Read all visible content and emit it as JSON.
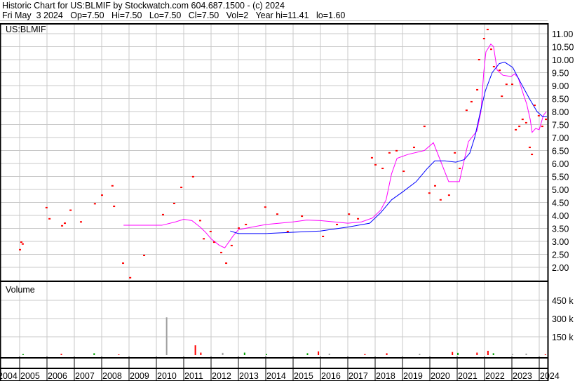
{
  "header": {
    "title": "Historic Chart for US:BLMIF by Stockwatch.com 604.687.1500 - (c) 2024",
    "quote": "Fri May  3 2024   Op=7.50   Hi=7.50   Lo=7.50   Cl=7.50   Vol=2   Year hi=11.41   lo=1.60"
  },
  "chart_data": {
    "type": "line",
    "title": "US:BLMIF",
    "volume_label": "Volume",
    "colors": {
      "price": "#ff0000",
      "ma_short": "#ff00ff",
      "ma_long": "#0000ff",
      "grid": "#c8c8c8",
      "vol_up": "#00a000",
      "vol_down": "#ff0000",
      "vol_flat": "#a0a0a0"
    },
    "price_axis": {
      "range": [
        1.6,
        11.4
      ],
      "ticks": [
        "11.00",
        "10.50",
        "10.00",
        "9.50",
        "9.00",
        "8.50",
        "8.00",
        "7.50",
        "7.00",
        "6.50",
        "6.00",
        "5.50",
        "5.00",
        "4.50",
        "4.00",
        "3.50",
        "3.00",
        "2.50",
        "2.00"
      ]
    },
    "volume_axis": {
      "range": [
        0,
        500000
      ],
      "ticks": [
        {
          "v": 450000,
          "label": "450 k"
        },
        {
          "v": 300000,
          "label": "300 k"
        },
        {
          "v": 150000,
          "label": "150 k"
        }
      ]
    },
    "x_axis": {
      "range": [
        2004.3,
        2024.4
      ],
      "years": [
        "2004",
        "2005",
        "2006",
        "2007",
        "2008",
        "2009",
        "2010",
        "2011",
        "2012",
        "2013",
        "2014",
        "2015",
        "2016",
        "2017",
        "2018",
        "2019",
        "2020",
        "2021",
        "2022",
        "2023",
        "2024"
      ]
    },
    "prices": [
      [
        2005.0,
        2.68
      ],
      [
        2005.05,
        2.97
      ],
      [
        2005.1,
        2.9
      ],
      [
        2005.97,
        4.3
      ],
      [
        2006.08,
        3.87
      ],
      [
        2006.54,
        3.6
      ],
      [
        2006.64,
        3.7
      ],
      [
        2006.85,
        4.2
      ],
      [
        2007.23,
        3.75
      ],
      [
        2007.74,
        4.45
      ],
      [
        2008.0,
        4.78
      ],
      [
        2008.38,
        5.14
      ],
      [
        2008.44,
        4.35
      ],
      [
        2008.77,
        2.16
      ],
      [
        2009.03,
        1.6
      ],
      [
        2009.54,
        2.46
      ],
      [
        2010.23,
        4.03
      ],
      [
        2010.64,
        4.46
      ],
      [
        2010.9,
        5.08
      ],
      [
        2011.33,
        5.49
      ],
      [
        2011.59,
        3.8
      ],
      [
        2011.72,
        3.1
      ],
      [
        2011.97,
        3.38
      ],
      [
        2012.1,
        2.97
      ],
      [
        2012.36,
        2.57
      ],
      [
        2012.54,
        2.16
      ],
      [
        2012.74,
        2.84
      ],
      [
        2013.0,
        3.51
      ],
      [
        2013.26,
        3.65
      ],
      [
        2013.97,
        4.32
      ],
      [
        2014.41,
        4.05
      ],
      [
        2014.79,
        3.38
      ],
      [
        2015.31,
        3.97
      ],
      [
        2016.08,
        3.19
      ],
      [
        2016.59,
        3.65
      ],
      [
        2017.03,
        4.05
      ],
      [
        2017.36,
        3.87
      ],
      [
        2017.87,
        6.22
      ],
      [
        2018.0,
        5.95
      ],
      [
        2018.26,
        5.81
      ],
      [
        2018.51,
        6.41
      ],
      [
        2018.77,
        6.49
      ],
      [
        2019.03,
        5.7
      ],
      [
        2019.41,
        6.62
      ],
      [
        2019.79,
        7.43
      ],
      [
        2019.97,
        4.86
      ],
      [
        2020.18,
        5.14
      ],
      [
        2020.38,
        4.6
      ],
      [
        2020.69,
        4.78
      ],
      [
        2020.9,
        6.41
      ],
      [
        2021.08,
        5.81
      ],
      [
        2021.33,
        8.05
      ],
      [
        2021.51,
        8.38
      ],
      [
        2021.72,
        8.84
      ],
      [
        2021.79,
        10.0
      ],
      [
        2021.97,
        10.81
      ],
      [
        2022.1,
        11.16
      ],
      [
        2022.23,
        10.4
      ],
      [
        2022.33,
        9.73
      ],
      [
        2022.54,
        9.59
      ],
      [
        2022.62,
        8.59
      ],
      [
        2022.79,
        9.05
      ],
      [
        2023.0,
        9.05
      ],
      [
        2023.13,
        7.3
      ],
      [
        2023.26,
        7.43
      ],
      [
        2023.38,
        7.7
      ],
      [
        2023.51,
        7.57
      ],
      [
        2023.64,
        6.62
      ],
      [
        2023.72,
        6.35
      ],
      [
        2023.82,
        8.24
      ],
      [
        2023.97,
        7.84
      ],
      [
        2024.1,
        7.43
      ],
      [
        2024.23,
        7.7
      ]
    ],
    "series": [
      {
        "name": "short moving average",
        "points": [
          [
            2008.8,
            3.62
          ],
          [
            2009.5,
            3.62
          ],
          [
            2010.2,
            3.62
          ],
          [
            2010.7,
            3.75
          ],
          [
            2011.0,
            3.85
          ],
          [
            2011.3,
            3.8
          ],
          [
            2011.6,
            3.55
          ],
          [
            2011.8,
            3.35
          ],
          [
            2012.0,
            3.1
          ],
          [
            2012.3,
            2.85
          ],
          [
            2012.5,
            2.75
          ],
          [
            2012.8,
            3.2
          ],
          [
            2013.0,
            3.45
          ],
          [
            2013.5,
            3.55
          ],
          [
            2014.0,
            3.65
          ],
          [
            2014.5,
            3.7
          ],
          [
            2015.0,
            3.75
          ],
          [
            2015.5,
            3.82
          ],
          [
            2016.0,
            3.8
          ],
          [
            2016.5,
            3.75
          ],
          [
            2017.0,
            3.7
          ],
          [
            2017.5,
            3.75
          ],
          [
            2017.9,
            3.9
          ],
          [
            2018.2,
            4.2
          ],
          [
            2018.4,
            4.6
          ],
          [
            2018.6,
            5.6
          ],
          [
            2018.8,
            6.2
          ],
          [
            2019.2,
            6.35
          ],
          [
            2019.8,
            6.5
          ],
          [
            2020.13,
            6.8
          ],
          [
            2020.69,
            5.3
          ],
          [
            2021.08,
            5.3
          ],
          [
            2021.41,
            6.84
          ],
          [
            2021.72,
            7.25
          ],
          [
            2021.87,
            8.0
          ],
          [
            2021.97,
            9.5
          ],
          [
            2022.05,
            10.3
          ],
          [
            2022.23,
            10.6
          ],
          [
            2022.33,
            10.5
          ],
          [
            2022.46,
            9.6
          ],
          [
            2022.67,
            9.4
          ],
          [
            2022.97,
            9.35
          ],
          [
            2023.1,
            9.45
          ],
          [
            2023.23,
            9.3
          ],
          [
            2023.44,
            8.6
          ],
          [
            2023.54,
            8.3
          ],
          [
            2023.67,
            7.7
          ],
          [
            2023.74,
            7.2
          ],
          [
            2023.87,
            7.35
          ],
          [
            2024.0,
            7.3
          ],
          [
            2024.15,
            7.85
          ],
          [
            2024.26,
            8.0
          ]
        ]
      },
      {
        "name": "long moving average",
        "points": [
          [
            2012.7,
            3.4
          ],
          [
            2013.0,
            3.3
          ],
          [
            2014.0,
            3.3
          ],
          [
            2015.0,
            3.35
          ],
          [
            2016.0,
            3.4
          ],
          [
            2017.0,
            3.55
          ],
          [
            2017.8,
            3.7
          ],
          [
            2018.2,
            4.1
          ],
          [
            2018.6,
            4.6
          ],
          [
            2019.0,
            4.9
          ],
          [
            2019.5,
            5.3
          ],
          [
            2019.9,
            5.8
          ],
          [
            2020.18,
            6.1
          ],
          [
            2020.56,
            6.1
          ],
          [
            2020.95,
            6.05
          ],
          [
            2021.26,
            6.15
          ],
          [
            2021.46,
            6.4
          ],
          [
            2021.64,
            7.0
          ],
          [
            2021.85,
            8.0
          ],
          [
            2022.03,
            8.8
          ],
          [
            2022.28,
            9.5
          ],
          [
            2022.54,
            9.85
          ],
          [
            2022.74,
            9.9
          ],
          [
            2023.03,
            9.7
          ],
          [
            2023.33,
            9.1
          ],
          [
            2023.64,
            8.5
          ],
          [
            2023.92,
            8.0
          ],
          [
            2024.13,
            7.8
          ],
          [
            2024.28,
            7.8
          ]
        ]
      }
    ],
    "volume": [
      [
        2005.1,
        8000,
        "up"
      ],
      [
        2006.5,
        10000,
        "down"
      ],
      [
        2007.7,
        15000,
        "up"
      ],
      [
        2008.6,
        5000,
        "down"
      ],
      [
        2010.35,
        310000,
        "flat"
      ],
      [
        2011.4,
        80000,
        "down"
      ],
      [
        2011.6,
        20000,
        "down"
      ],
      [
        2012.4,
        18000,
        "flat"
      ],
      [
        2013.2,
        20000,
        "up"
      ],
      [
        2014.0,
        8000,
        "up"
      ],
      [
        2015.5,
        15000,
        "up"
      ],
      [
        2015.9,
        30000,
        "down"
      ],
      [
        2016.3,
        12000,
        "flat"
      ],
      [
        2017.6,
        8000,
        "down"
      ],
      [
        2018.4,
        15000,
        "down"
      ],
      [
        2019.6,
        10000,
        "flat"
      ],
      [
        2020.8,
        25000,
        "down"
      ],
      [
        2021.0,
        18000,
        "up"
      ],
      [
        2021.7,
        20000,
        "down"
      ],
      [
        2022.1,
        35000,
        "down"
      ],
      [
        2022.3,
        15000,
        "up"
      ],
      [
        2023.0,
        8000,
        "flat"
      ],
      [
        2023.5,
        12000,
        "flat"
      ],
      [
        2024.2,
        6000,
        "down"
      ]
    ]
  }
}
